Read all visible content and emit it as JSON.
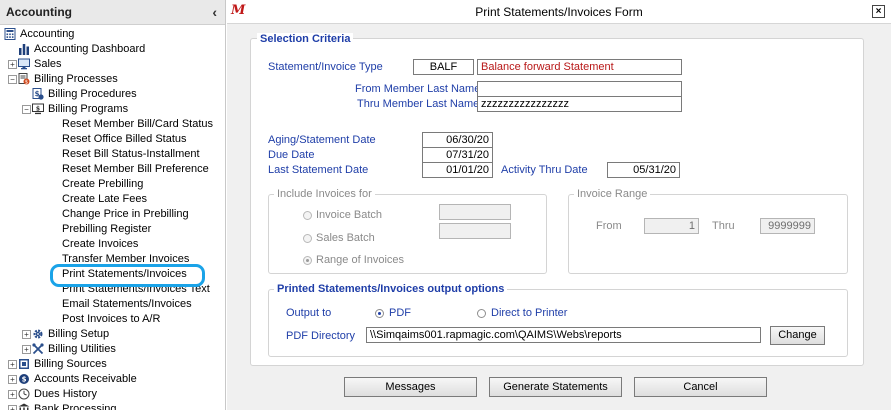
{
  "sidebar": {
    "header": "Accounting",
    "collapse_glyph": "‹",
    "items": [
      {
        "label": "Accounting",
        "level": 0,
        "toggle": "",
        "icon": "calculator-icon"
      },
      {
        "label": "Accounting Dashboard",
        "level": 1,
        "toggle": "",
        "icon": "bar-chart-icon"
      },
      {
        "label": "Sales",
        "level": 1,
        "toggle": "+",
        "icon": "monitor-icon"
      },
      {
        "label": "Billing Processes",
        "level": 1,
        "toggle": "−",
        "icon": "billing-processes-icon"
      },
      {
        "label": "Billing Procedures",
        "level": 2,
        "toggle": "",
        "icon": "billing-procedures-icon"
      },
      {
        "label": "Billing Programs",
        "level": 2,
        "toggle": "−",
        "icon": "billing-programs-icon"
      },
      {
        "label": "Reset Member Bill/Card Status",
        "level": 3,
        "toggle": "",
        "icon": ""
      },
      {
        "label": "Reset Office Billed Status",
        "level": 3,
        "toggle": "",
        "icon": ""
      },
      {
        "label": "Reset Bill Status-Installment",
        "level": 3,
        "toggle": "",
        "icon": ""
      },
      {
        "label": "Reset Member Bill Preference",
        "level": 3,
        "toggle": "",
        "icon": ""
      },
      {
        "label": "Create Prebilling",
        "level": 3,
        "toggle": "",
        "icon": ""
      },
      {
        "label": "Create Late Fees",
        "level": 3,
        "toggle": "",
        "icon": ""
      },
      {
        "label": "Change Price in Prebilling",
        "level": 3,
        "toggle": "",
        "icon": ""
      },
      {
        "label": "Prebilling Register",
        "level": 3,
        "toggle": "",
        "icon": ""
      },
      {
        "label": "Create Invoices",
        "level": 3,
        "toggle": "",
        "icon": ""
      },
      {
        "label": "Transfer Member Invoices",
        "level": 3,
        "toggle": "",
        "icon": ""
      },
      {
        "label": "Print Statements/Invoices",
        "level": 3,
        "toggle": "",
        "icon": ""
      },
      {
        "label": "Print Statements/Invoices Text",
        "level": 3,
        "toggle": "",
        "icon": ""
      },
      {
        "label": "Email Statements/Invoices",
        "level": 3,
        "toggle": "",
        "icon": ""
      },
      {
        "label": "Post Invoices to A/R",
        "level": 3,
        "toggle": "",
        "icon": ""
      },
      {
        "label": "Billing Setup",
        "level": 2,
        "toggle": "+",
        "icon": "gear-icon"
      },
      {
        "label": "Billing Utilities",
        "level": 2,
        "toggle": "+",
        "icon": "tools-icon"
      },
      {
        "label": "Billing Sources",
        "level": 1,
        "toggle": "+",
        "icon": "billing-sources-icon"
      },
      {
        "label": "Accounts Receivable",
        "level": 1,
        "toggle": "+",
        "icon": "accounts-receivable-icon"
      },
      {
        "label": "Dues History",
        "level": 1,
        "toggle": "+",
        "icon": "dues-history-icon"
      },
      {
        "label": "Bank Processing",
        "level": 1,
        "toggle": "+",
        "icon": "bank-icon"
      }
    ]
  },
  "form": {
    "title_logo": "M",
    "title": "Print Statements/Invoices Form",
    "close_glyph": "×",
    "selection_criteria": "Selection Criteria",
    "statement_type_label": "Statement/Invoice Type",
    "statement_type_code": "BALF",
    "statement_type_desc": "Balance forward Statement",
    "from_last_name_label": "From Member Last Name",
    "from_last_name_value": "",
    "thru_last_name_label": "Thru Member Last Name",
    "thru_last_name_value": "zzzzzzzzzzzzzzzz",
    "aging_date_label": "Aging/Statement Date",
    "aging_date_value": "06/30/20",
    "due_date_label": "Due Date",
    "due_date_value": "07/31/20",
    "last_statement_label": "Last Statement Date",
    "last_statement_value": "01/01/20",
    "activity_thru_label": "Activity Thru Date",
    "activity_thru_value": "05/31/20",
    "include_invoices": {
      "legend": "Include Invoices for",
      "invoice_batch": "Invoice Batch",
      "invoice_batch_value": "",
      "sales_batch": "Sales Batch",
      "sales_batch_value": "",
      "range_of_invoices": "Range of Invoices",
      "selected": "range_of_invoices"
    },
    "invoice_range": {
      "legend": "Invoice Range",
      "from_label": "From",
      "from_value": "1",
      "thru_label": "Thru",
      "thru_value": "9999999"
    },
    "output_options": {
      "legend": "Printed Statements/Invoices output options",
      "output_to_label": "Output to",
      "pdf_label": "PDF",
      "printer_label": "Direct to Printer",
      "selected": "pdf",
      "pdf_directory_label": "PDF Directory",
      "pdf_directory_value": "\\\\Simqaims001.rapmagic.com\\QAIMS\\Webs\\reports",
      "change_button": "Change"
    },
    "buttons": {
      "messages": "Messages",
      "generate": "Generate Statements",
      "cancel": "Cancel"
    }
  },
  "colors": {
    "label_blue": "#1f3ea8",
    "desc_red": "#b81818",
    "highlight_ring": "#1aa3e8"
  }
}
